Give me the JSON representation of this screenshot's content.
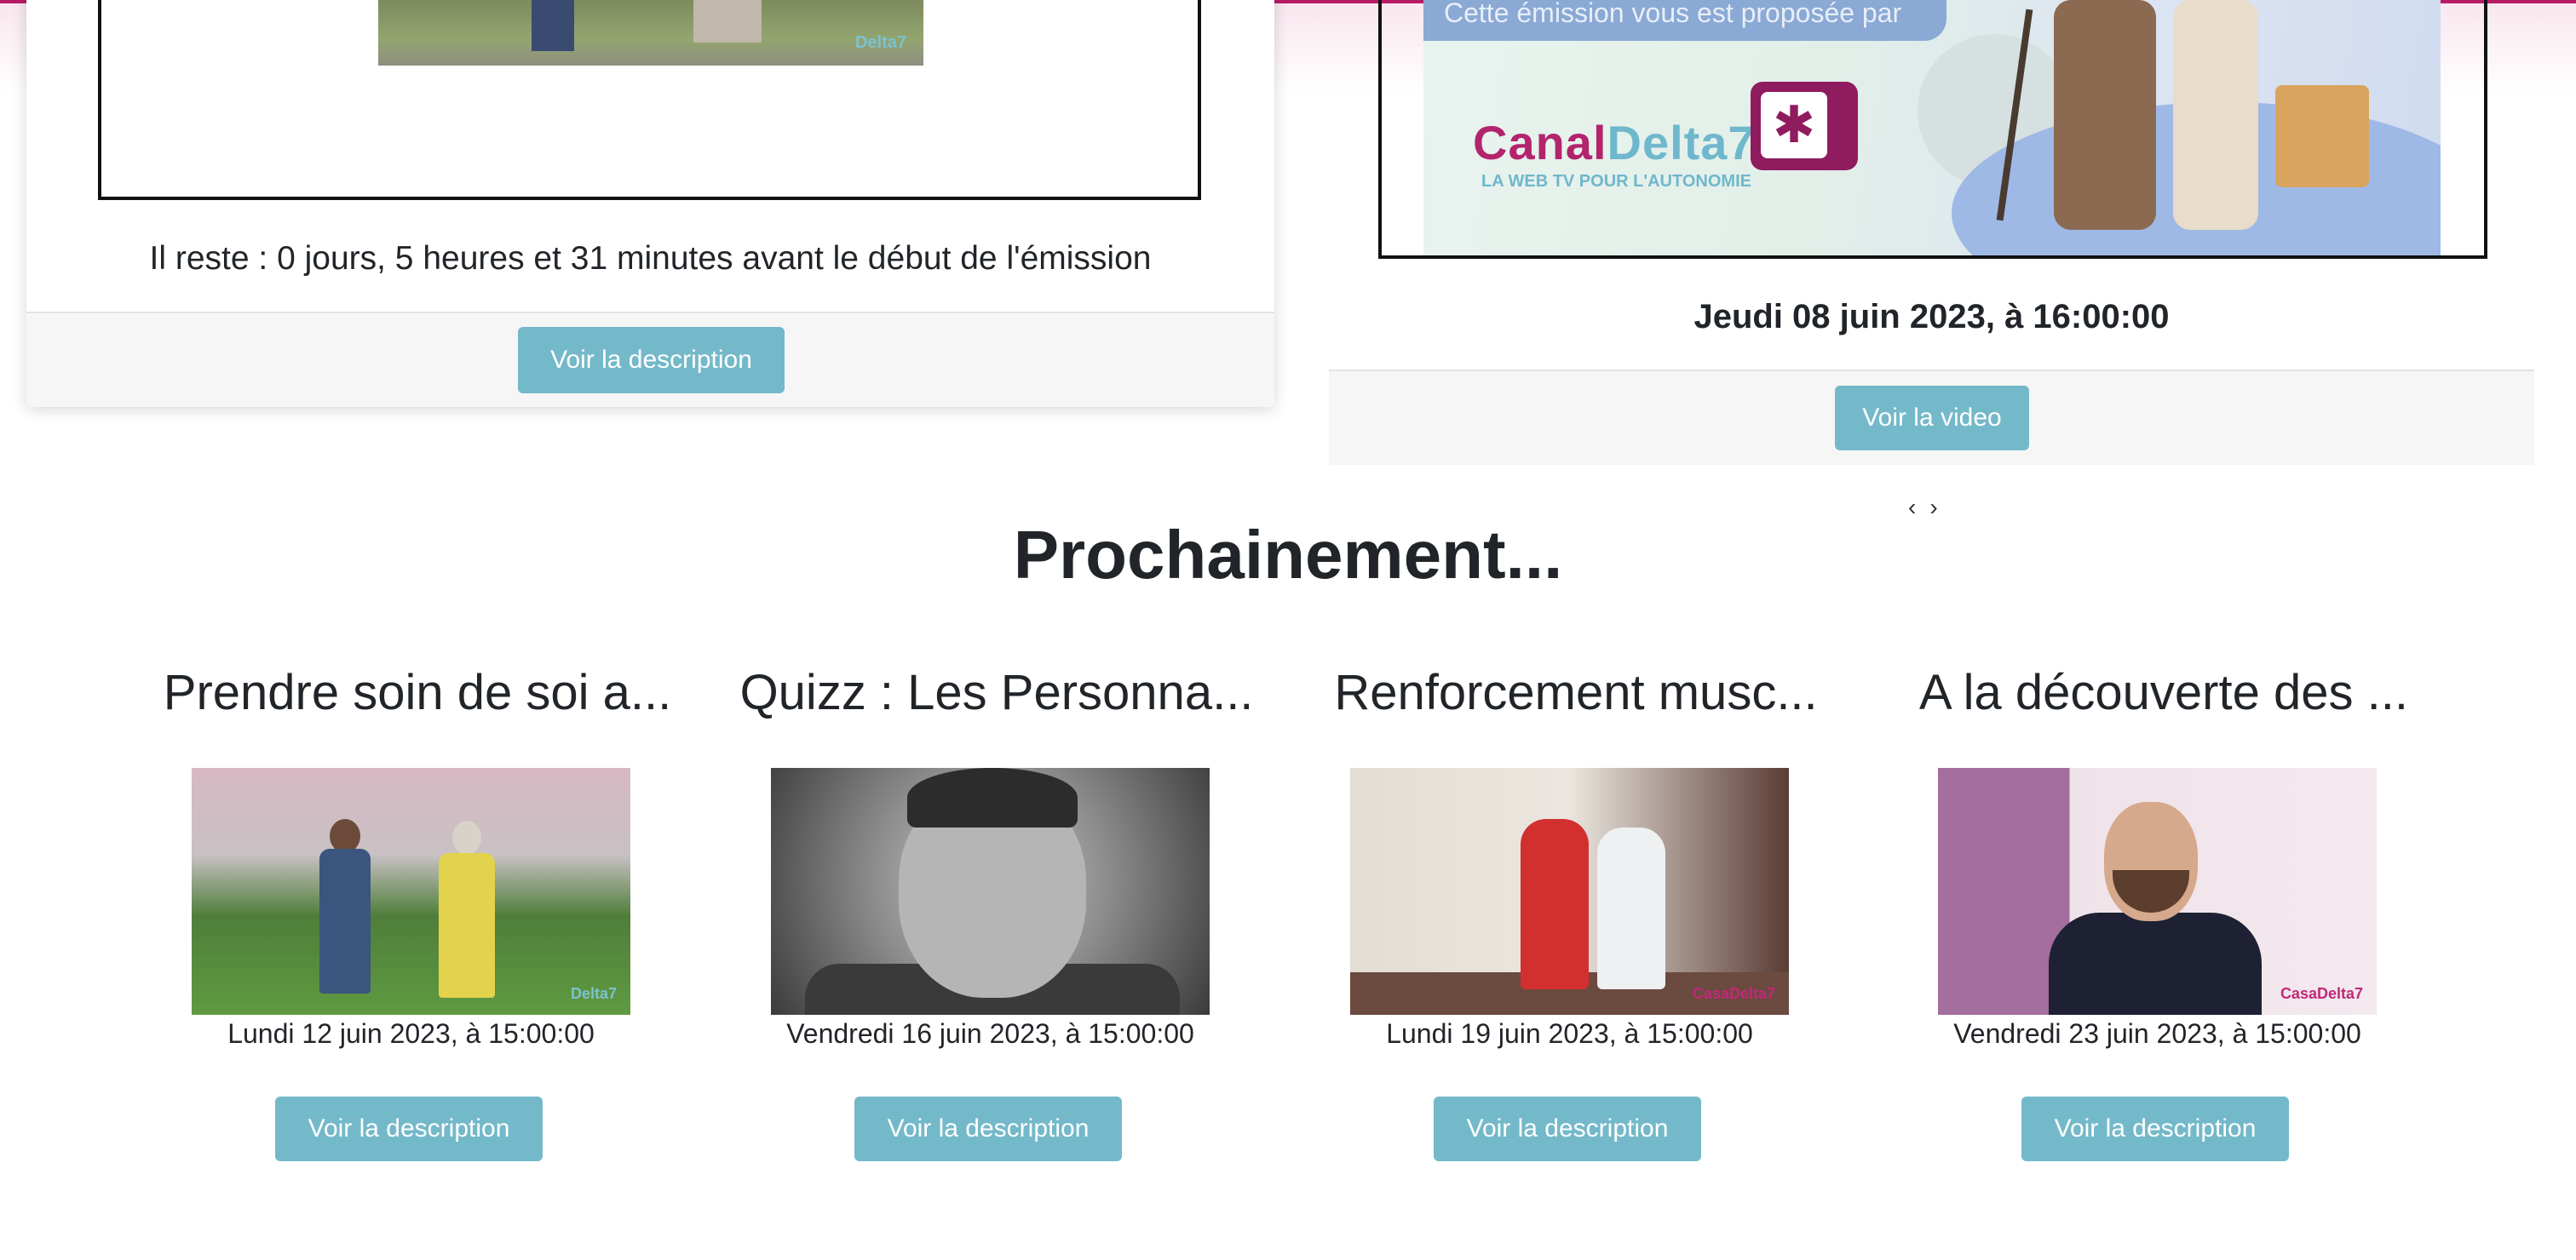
{
  "left_card": {
    "thumbnail_watermark": "Delta7",
    "countdown": "Il reste : 0 jours, 5 heures et 31 minutes avant le début de l'émission",
    "button": "Voir la description"
  },
  "right_card": {
    "promo": {
      "banner_text": "Cette émission vous est proposée par",
      "logo_canal": "Canal",
      "logo_delta": "Delta7",
      "tagline": "LA WEB TV POUR L'AUTONOMIE"
    },
    "date": "Jeudi 08 juin 2023, à 16:00:00",
    "button": "Voir la video"
  },
  "carousel": {
    "prev": "‹",
    "next": "›"
  },
  "section_title": "Prochainement...",
  "upcoming": [
    {
      "title": "Prendre soin de soi a...",
      "date": "Lundi 12 juin 2023, à 15:00:00",
      "button": "Voir la description",
      "watermark": "Delta7"
    },
    {
      "title": "Quizz : Les Personna...",
      "date": "Vendredi 16 juin 2023, à 15:00:00",
      "button": "Voir la description"
    },
    {
      "title": "Renforcement musc...",
      "date": "Lundi 19 juin 2023, à 15:00:00",
      "button": "Voir la description",
      "watermark": "CasaDelta7"
    },
    {
      "title": "A la découverte des ...",
      "date": "Vendredi 23 juin 2023, à 15:00:00",
      "button": "Voir la description",
      "watermark": "CasaDelta7"
    }
  ],
  "colors": {
    "accent_bar": "#b81b66",
    "button_bg": "#74b9c9",
    "button_text": "#ffffff"
  }
}
